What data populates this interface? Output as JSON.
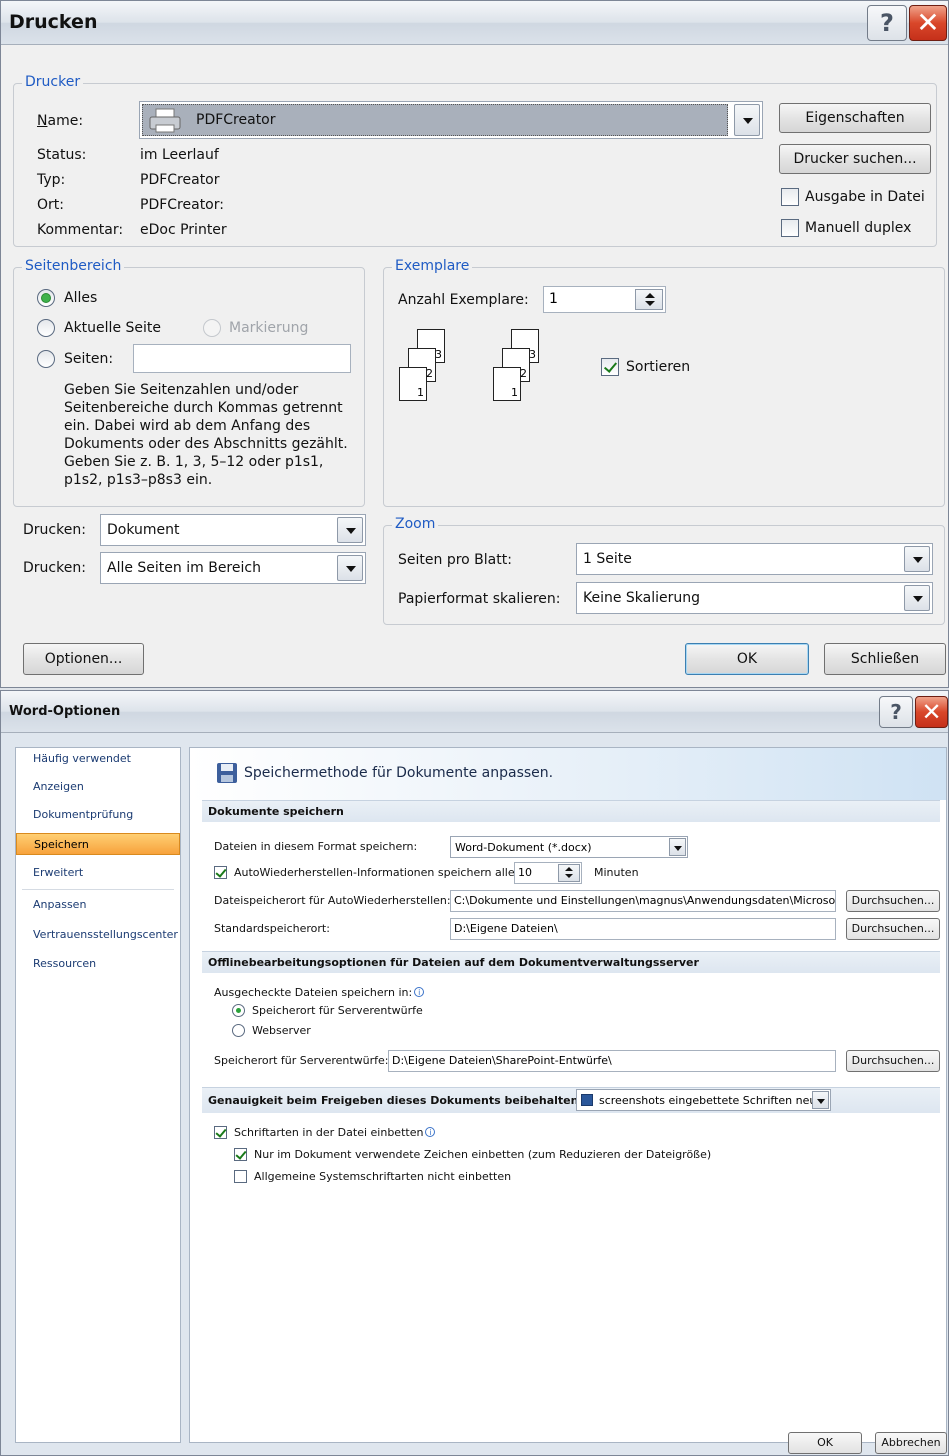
{
  "print_dialog": {
    "title": "Drucken",
    "help_glyph": "?",
    "close_glyph": "✕",
    "printer": {
      "legend": "Drucker",
      "name_label": "Name:",
      "name_value": "PDFCreator",
      "status_label": "Status:",
      "status_value": "im Leerlauf",
      "type_label": "Typ:",
      "type_value": "PDFCreator",
      "location_label": "Ort:",
      "location_value": "PDFCreator:",
      "comment_label": "Kommentar:",
      "comment_value": "eDoc Printer",
      "properties_button": "Eigenschaften",
      "find_printer_button": "Drucker suchen...",
      "print_to_file_label": "Ausgabe in Datei",
      "manual_duplex_label": "Manuell duplex",
      "print_to_file_checked": false,
      "manual_duplex_checked": false
    },
    "page_range": {
      "legend": "Seitenbereich",
      "all_label": "Alles",
      "current_page_label": "Aktuelle Seite",
      "selection_label": "Markierung",
      "pages_label": "Seiten:",
      "pages_value": "",
      "help_text": "Geben Sie Seitenzahlen und/oder Seitenbereiche durch Kommas getrennt ein. Dabei wird ab dem Anfang des Dokuments oder des Abschnitts gezählt. Geben Sie z. B. 1, 3, 5–12 oder p1s1, p1s2, p1s3–p8s3 ein.",
      "selected": "all"
    },
    "copies": {
      "legend": "Exemplare",
      "count_label": "Anzahl Exemplare:",
      "count_value": "1",
      "collate_label": "Sortieren",
      "collate_checked": true,
      "page_numbers": [
        "3",
        "2",
        "1"
      ]
    },
    "print_what_label": "Drucken:",
    "print_what_value": "Dokument",
    "print_pages_label": "Drucken:",
    "print_pages_value": "Alle Seiten im Bereich",
    "zoom": {
      "legend": "Zoom",
      "pages_per_sheet_label": "Seiten pro Blatt:",
      "pages_per_sheet_value": "1 Seite",
      "scale_label": "Papierformat skalieren:",
      "scale_value": "Keine Skalierung"
    },
    "options_button": "Optionen...",
    "ok_button": "OK",
    "close_button": "Schließen"
  },
  "word_options": {
    "title": "Word-Optionen",
    "help_glyph": "?",
    "close_glyph": "✕",
    "sidebar": [
      "Häufig verwendet",
      "Anzeigen",
      "Dokumentprüfung",
      "Speichern",
      "Erweitert",
      "Anpassen",
      "Vertrauensstellungscenter",
      "Ressourcen"
    ],
    "selected_item": "Speichern",
    "header": "Speichermethode für Dokumente anpassen.",
    "save_section": {
      "title": "Dokumente speichern",
      "format_label": "Dateien in diesem Format speichern:",
      "format_value": "Word-Dokument (*.docx)",
      "autorecover_label": "AutoWiederherstellen-Informationen speichern alle",
      "autorecover_checked": true,
      "autorecover_minutes": "10",
      "minutes_label": "Minuten",
      "autorecover_path_label": "Dateispeicherort für AutoWiederherstellen:",
      "autorecover_path_value": "C:\\Dokumente und Einstellungen\\magnus\\Anwendungsdaten\\Microsoft\\",
      "default_path_label": "Standardspeicherort:",
      "default_path_value": "D:\\Eigene Dateien\\",
      "browse_button": "Durchsuchen..."
    },
    "offline_section": {
      "title": "Offlinebearbeitungsoptionen für Dateien auf dem Dokumentverwaltungsserver",
      "checked_out_label": "Ausgecheckte Dateien speichern in:",
      "info_glyph": "i",
      "server_drafts_label": "Speicherort für Serverentwürfe",
      "webserver_label": "Webserver",
      "selected": "server_drafts",
      "drafts_path_label": "Speicherort für Serverentwürfe:",
      "drafts_path_value": "D:\\Eigene Dateien\\SharePoint-Entwürfe\\",
      "browse_button": "Durchsuchen..."
    },
    "fidelity_section": {
      "title": "Genauigkeit beim Freigeben dieses Dokuments beibehalten:",
      "document_value": "screenshots eingebettete Schriften neu",
      "embed_fonts_label": "Schriftarten in der Datei einbetten",
      "embed_fonts_checked": true,
      "only_used_chars_label": "Nur im Dokument verwendete Zeichen einbetten (zum Reduzieren der Dateigröße)",
      "only_used_chars_checked": true,
      "no_system_fonts_label": "Allgemeine Systemschriftarten nicht einbetten",
      "no_system_fonts_checked": false
    },
    "ok_button": "OK",
    "cancel_button": "Abbrechen"
  },
  "colors": {
    "legend_blue": "#1f5bc4",
    "selected_orange": "#f7a23c",
    "close_red": "#d9472a"
  }
}
